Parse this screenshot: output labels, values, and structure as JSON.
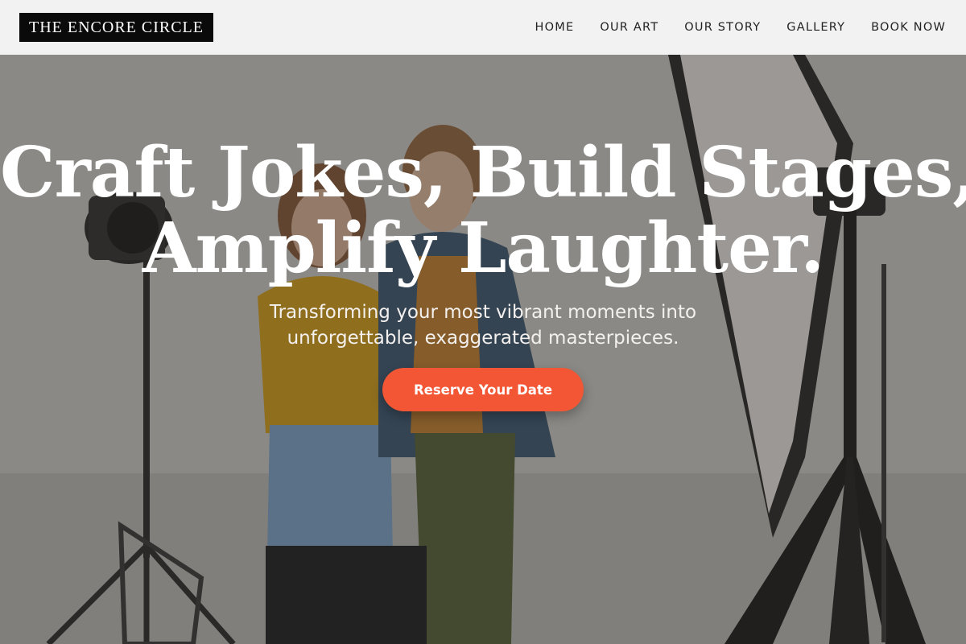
{
  "header": {
    "logo_text": "THE ENCORE CIRCLE",
    "nav": [
      {
        "label": "HOME"
      },
      {
        "label": "OUR ART"
      },
      {
        "label": "OUR STORY"
      },
      {
        "label": "GALLERY"
      },
      {
        "label": "BOOK NOW"
      }
    ]
  },
  "hero": {
    "headline_line1": "Craft Jokes, Build Stages,",
    "headline_line2": "Amplify Laughter.",
    "subtext_line1": "Transforming your most vibrant moments into",
    "subtext_line2": "unforgettable, exaggerated masterpieces.",
    "cta_label": "Reserve Your Date",
    "background": "photo-studio-couple-image"
  },
  "colors": {
    "accent": "#f25634",
    "header_bg": "#f2f2f2",
    "logo_bg": "#0a0a0a"
  }
}
